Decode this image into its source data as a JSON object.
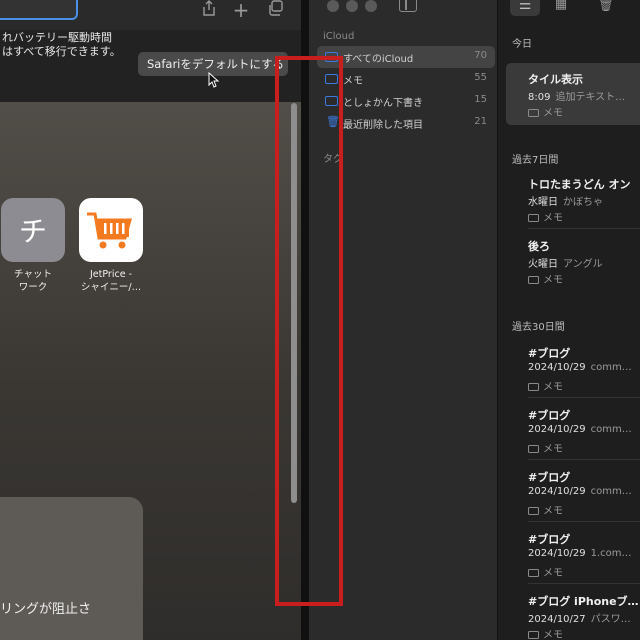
{
  "colors": {
    "accent": "#3b7be0",
    "highlight": "#c81e1e",
    "focus_ring": "#4a8fe8",
    "jetprice_orange": "#f47a20"
  },
  "safari": {
    "toolbar_icons": [
      "share-icon",
      "plus-icon",
      "tabs-overview-icon"
    ],
    "notice": {
      "text": "れバッテリー駆動時間\nはすべて移行できます。",
      "default_button": "Safariをデフォルトにする"
    },
    "favorites": [
      {
        "name": "チャット\nワーク",
        "tile_text": "チ",
        "icon": "chatwork-icon"
      },
      {
        "name": "JetPrice -\nシャイニー/…",
        "icon": "shopping-cart-icon"
      }
    ],
    "card_text": "リングが阻止さ"
  },
  "notes": {
    "sidebar": {
      "account_label": "iCloud",
      "folders": [
        {
          "name": "すべてのiCloud",
          "count": "70"
        },
        {
          "name": "メモ",
          "count": "55"
        },
        {
          "name": "としょかん下書き",
          "count": "15"
        },
        {
          "name": "最近削除した項目",
          "count": "21"
        }
      ],
      "tags_label": "タグ"
    },
    "list": {
      "sections": [
        {
          "heading": "今日",
          "notes": [
            {
              "title": "タイル表示",
              "date": "8:09",
              "preview": "追加テキスト…",
              "folder": "メモ"
            }
          ]
        },
        {
          "heading": "過去7日間",
          "notes": [
            {
              "title": "トロたまうどん オン",
              "date": "水曜日",
              "preview": "かぼちゃ",
              "folder": "メモ"
            },
            {
              "title": "後ろ",
              "date": "火曜日",
              "preview": "アングル",
              "folder": "メモ"
            }
          ]
        },
        {
          "heading": "過去30日間",
          "notes": [
            {
              "title": "#ブログ",
              "date": "2024/10/29",
              "preview": "comm…",
              "folder": "メモ"
            },
            {
              "title": "#ブログ",
              "date": "2024/10/29",
              "preview": "comm…",
              "folder": "メモ"
            },
            {
              "title": "#ブログ",
              "date": "2024/10/29",
              "preview": "comm…",
              "folder": "メモ"
            },
            {
              "title": "#ブログ",
              "date": "2024/10/29",
              "preview": "1.com…",
              "folder": "メモ"
            },
            {
              "title": "#ブログ iPhoneブ…",
              "date": "2024/10/27",
              "preview": "パスワ…",
              "folder": "メモ"
            }
          ]
        }
      ]
    }
  }
}
